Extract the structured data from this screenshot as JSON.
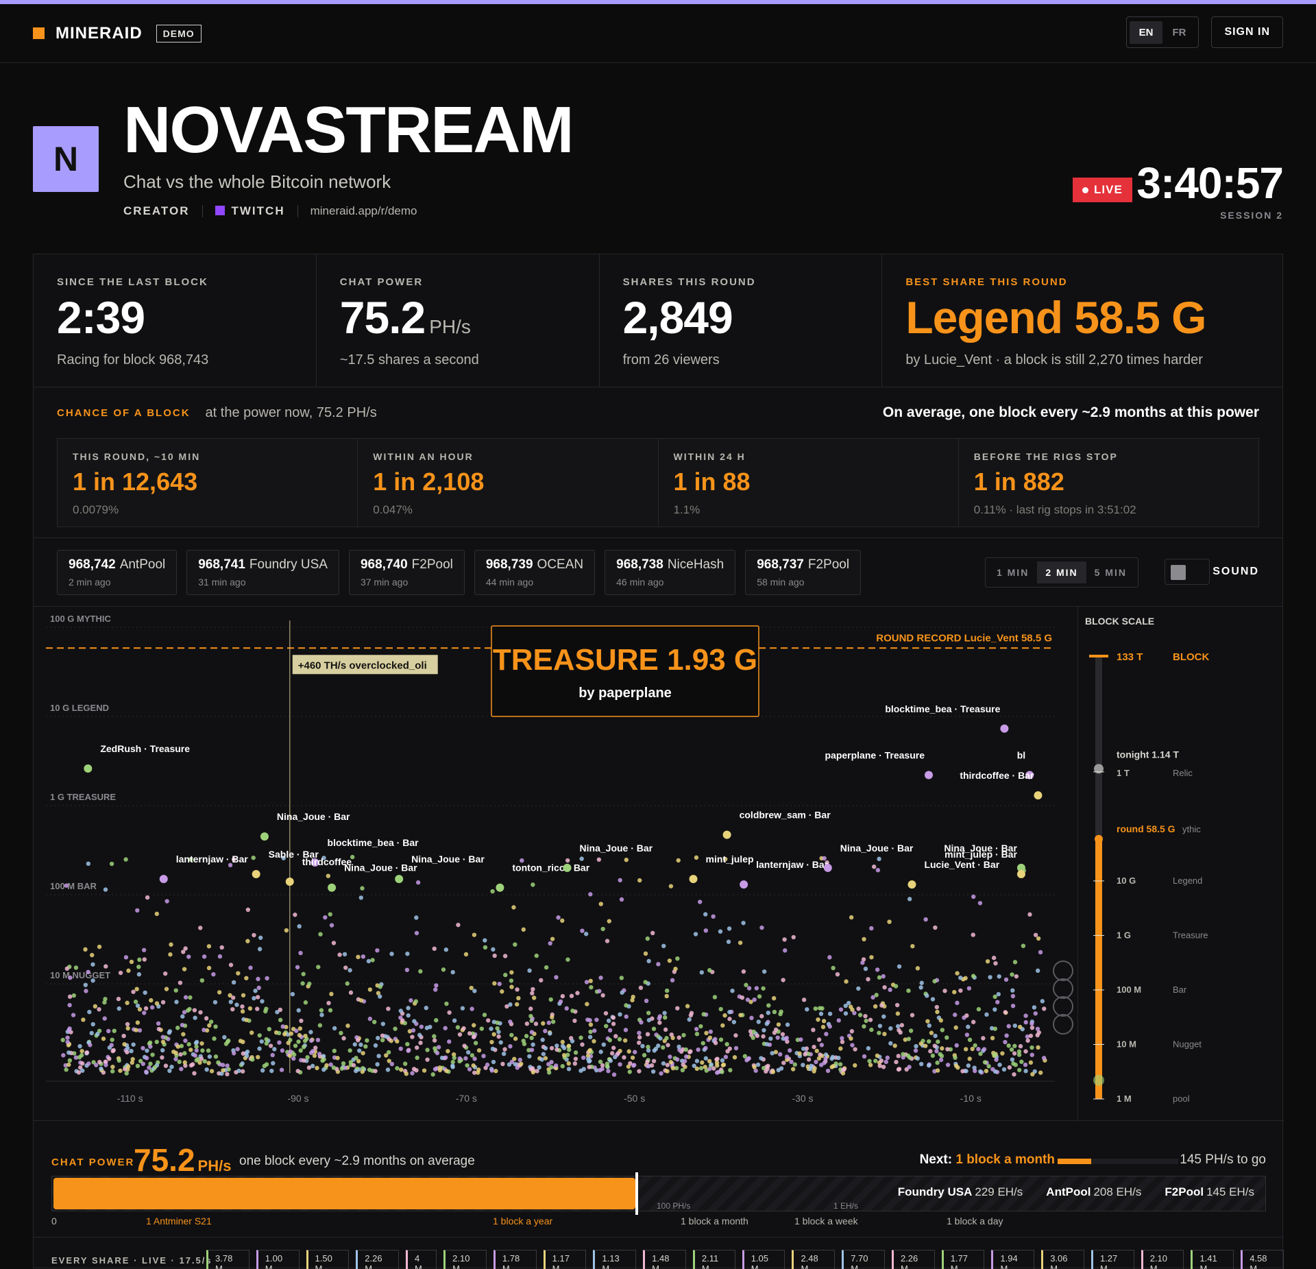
{
  "nav": {
    "brand": "MINERAID",
    "badge": "DEMO",
    "langs": [
      {
        "label": "EN",
        "active": true
      },
      {
        "label": "FR",
        "active": false
      }
    ],
    "sign_in": "SIGN IN"
  },
  "hero": {
    "avatar": "N",
    "title": "NOVASTREAM",
    "subtitle": "Chat vs the whole Bitcoin network",
    "role": "CREATOR",
    "platform": "TWITCH",
    "link": "mineraid.app/r/demo",
    "live": "LIVE",
    "timer": "3:40:57",
    "session": "SESSION 2"
  },
  "colors": {
    "accent": "#f7931a",
    "brand": "#a99cff",
    "live": "#e5313a",
    "twitch": "#9146ff"
  },
  "stats": [
    {
      "label": "SINCE THE LAST BLOCK",
      "value": "2:39",
      "unit": "",
      "desc": "Racing for block 968,743"
    },
    {
      "label": "CHAT POWER",
      "value": "75.2",
      "unit": "PH/s",
      "desc": "~17.5 shares a second"
    },
    {
      "label": "SHARES THIS ROUND",
      "value": "2,849",
      "unit": "",
      "desc": "from 26 viewers"
    },
    {
      "label": "BEST SHARE THIS ROUND",
      "value": "Legend 58.5 G",
      "unit": "",
      "desc": "by Lucie_Vent · a block is still 2,270 times harder"
    }
  ],
  "chance": {
    "label": "CHANCE OF A BLOCK",
    "context": "at the power now, 75.2 PH/s",
    "summary": "On average, one block every ~2.9 months at this power",
    "cells": [
      {
        "label": "THIS ROUND, ~10 MIN",
        "value": "1 in 12,643",
        "desc": "0.0079%"
      },
      {
        "label": "WITHIN AN HOUR",
        "value": "1 in 2,108",
        "desc": "0.047%"
      },
      {
        "label": "WITHIN 24 H",
        "value": "1 in 88",
        "desc": "1.1%"
      },
      {
        "label": "BEFORE THE RIGS STOP",
        "value": "1 in 882",
        "desc": "0.11% · last rig stops in 3:51:02"
      }
    ]
  },
  "recent_blocks": [
    {
      "height": "968,742",
      "pool": "AntPool",
      "ago": "2 min ago"
    },
    {
      "height": "968,741",
      "pool": "Foundry USA",
      "ago": "31 min ago"
    },
    {
      "height": "968,740",
      "pool": "F2Pool",
      "ago": "37 min ago"
    },
    {
      "height": "968,739",
      "pool": "OCEAN",
      "ago": "44 min ago"
    },
    {
      "height": "968,738",
      "pool": "NiceHash",
      "ago": "46 min ago"
    },
    {
      "height": "968,737",
      "pool": "F2Pool",
      "ago": "58 min ago"
    }
  ],
  "window": {
    "options": [
      {
        "label": "1 MIN",
        "active": false
      },
      {
        "label": "2 MIN",
        "active": true
      },
      {
        "label": "5 MIN",
        "active": false
      }
    ],
    "sound": "SOUND"
  },
  "chart_data": {
    "type": "scatter",
    "title": "",
    "xlabel": "",
    "ylabel": "",
    "x_ticks": [
      "-110 s",
      "-90 s",
      "-70 s",
      "-50 s",
      "-30 s",
      "-10 s"
    ],
    "y_tiers": [
      {
        "label": "100 G  MYTHIC",
        "value": 100000000000
      },
      {
        "label": "10 G  LEGEND",
        "value": 10000000000
      },
      {
        "label": "1 G  TREASURE",
        "value": 1000000000
      },
      {
        "label": "100 M  BAR",
        "value": 100000000
      },
      {
        "label": "10 M  NUGGET",
        "value": 10000000
      }
    ],
    "xlim": [
      -120,
      0
    ],
    "ylim": [
      1000000,
      100000000000
    ],
    "scale": "log",
    "record_label": "ROUND RECORD  Lucie_Vent  58.5 G",
    "record_value": 58500000000,
    "treasure_popup": {
      "title": "TREASURE 1.93 G",
      "by": "by paperplane"
    },
    "event": {
      "x": -91,
      "label": "+460 TH/s  overclocked_oli"
    },
    "labeled_points": [
      {
        "x": -115,
        "y": 2600000000,
        "label": "ZedRush · Treasure",
        "color": "#9ed27a"
      },
      {
        "x": -6,
        "y": 7300000000,
        "label": "blocktime_bea · Treasure",
        "color": "#c79be6"
      },
      {
        "x": -15,
        "y": 2200000000,
        "label": "paperplane · Treasure",
        "color": "#c79be6"
      },
      {
        "x": -3,
        "y": 2200000000,
        "label": "bl",
        "color": "#c79be6"
      },
      {
        "x": -2,
        "y": 1300000000,
        "label": "thirdcoffee · Bar",
        "color": "#e8d27a"
      },
      {
        "x": -94,
        "y": 450000000,
        "label": "Nina_Joue · Bar",
        "color": "#9ed27a"
      },
      {
        "x": -88,
        "y": 230000000,
        "label": "blocktime_bea · Bar",
        "color": "#c79be6"
      },
      {
        "x": -95,
        "y": 170000000,
        "label": "Sable · Bar",
        "color": "#e8d27a"
      },
      {
        "x": -91,
        "y": 140000000,
        "label": "thirdcoffee",
        "color": "#e8d27a"
      },
      {
        "x": -86,
        "y": 120000000,
        "label": "Nina_Joue · Bar",
        "color": "#9ed27a"
      },
      {
        "x": -78,
        "y": 150000000,
        "label": "Nina_Joue · Bar",
        "color": "#9ed27a"
      },
      {
        "x": -66,
        "y": 120000000,
        "label": "tonton_rico · Bar",
        "color": "#9ed27a"
      },
      {
        "x": -58,
        "y": 200000000,
        "label": "Nina_Joue · Bar",
        "color": "#9ed27a"
      },
      {
        "x": -106,
        "y": 150000000,
        "label": "lanternjaw · Bar",
        "color": "#c79be6"
      },
      {
        "x": -39,
        "y": 470000000,
        "label": "coldbrew_sam · Bar",
        "color": "#e8d27a"
      },
      {
        "x": -43,
        "y": 150000000,
        "label": "mint_julep",
        "color": "#e8d27a"
      },
      {
        "x": -37,
        "y": 130000000,
        "label": "lanternjaw · Bar",
        "color": "#c79be6"
      },
      {
        "x": -27,
        "y": 200000000,
        "label": "Nina_Joue · Bar",
        "color": "#c79be6"
      },
      {
        "x": -17,
        "y": 130000000,
        "label": "Lucie_Vent · Bar",
        "color": "#e8d27a"
      },
      {
        "x": -4,
        "y": 200000000,
        "label": "Nina_Joue · Bar",
        "color": "#9ed27a"
      },
      {
        "x": -4,
        "y": 170000000,
        "label": "mint_julep · Bar",
        "color": "#e8d27a"
      }
    ],
    "point_colors": [
      "#9ed27a",
      "#c79be6",
      "#e8d27a",
      "#9fc3e8",
      "#f2b8d4"
    ]
  },
  "block_scale": {
    "title": "BLOCK SCALE",
    "top": {
      "value": "133 T",
      "label": "BLOCK"
    },
    "tonight": {
      "value": "tonight 1.14 T"
    },
    "round": {
      "value": "round 58.5 G",
      "label": "ythic"
    },
    "levels": [
      {
        "value": "1 T",
        "label": "Relic"
      },
      {
        "value": "10 G",
        "label": "Legend"
      },
      {
        "value": "1 G",
        "label": "Treasure"
      },
      {
        "value": "100 M",
        "label": "Bar"
      },
      {
        "value": "10 M",
        "label": "Nugget"
      },
      {
        "value": "1 M",
        "label": "pool"
      }
    ]
  },
  "power_bar": {
    "label": "CHAT POWER",
    "value": "75.2",
    "unit": "PH/s",
    "desc": "one block every ~2.9 months on average",
    "next_prefix": "Next:",
    "next_label": "1 block a month",
    "togo": "145 PH/s to go",
    "fill_fraction": 0.48,
    "next_progress": 0.28,
    "markers": [
      {
        "label": "100 PH/s"
      },
      {
        "label": "1 EH/s"
      }
    ],
    "pools": [
      {
        "name": "Foundry USA",
        "rate": "229 EH/s"
      },
      {
        "name": "AntPool",
        "rate": "208 EH/s"
      },
      {
        "name": "F2Pool",
        "rate": "145 EH/s"
      }
    ],
    "ticks": [
      {
        "label": "0",
        "accent": false
      },
      {
        "label": "1 Antminer S21",
        "accent": true
      },
      {
        "label": "1 block a year",
        "accent": true
      },
      {
        "label": "1 block a month",
        "accent": false
      },
      {
        "label": "1 block a week",
        "accent": false
      },
      {
        "label": "1 block a day",
        "accent": false
      }
    ]
  },
  "shares_feed": {
    "label": "EVERY SHARE · LIVE · 17.5/s",
    "items": [
      "3.78 M",
      "1.00 M",
      "1.50 M",
      "2.26 M",
      "4 M",
      "2.10 M",
      "1.78 M",
      "1.17 M",
      "1.13 M",
      "1.48 M",
      "2.11 M",
      "1.05 M",
      "2.48 M",
      "7.70 M",
      "2.26 M",
      "1.77 M",
      "1.94 M",
      "3.06 M",
      "1.27 M",
      "2.10 M",
      "1.41 M",
      "4.58 M"
    ]
  }
}
